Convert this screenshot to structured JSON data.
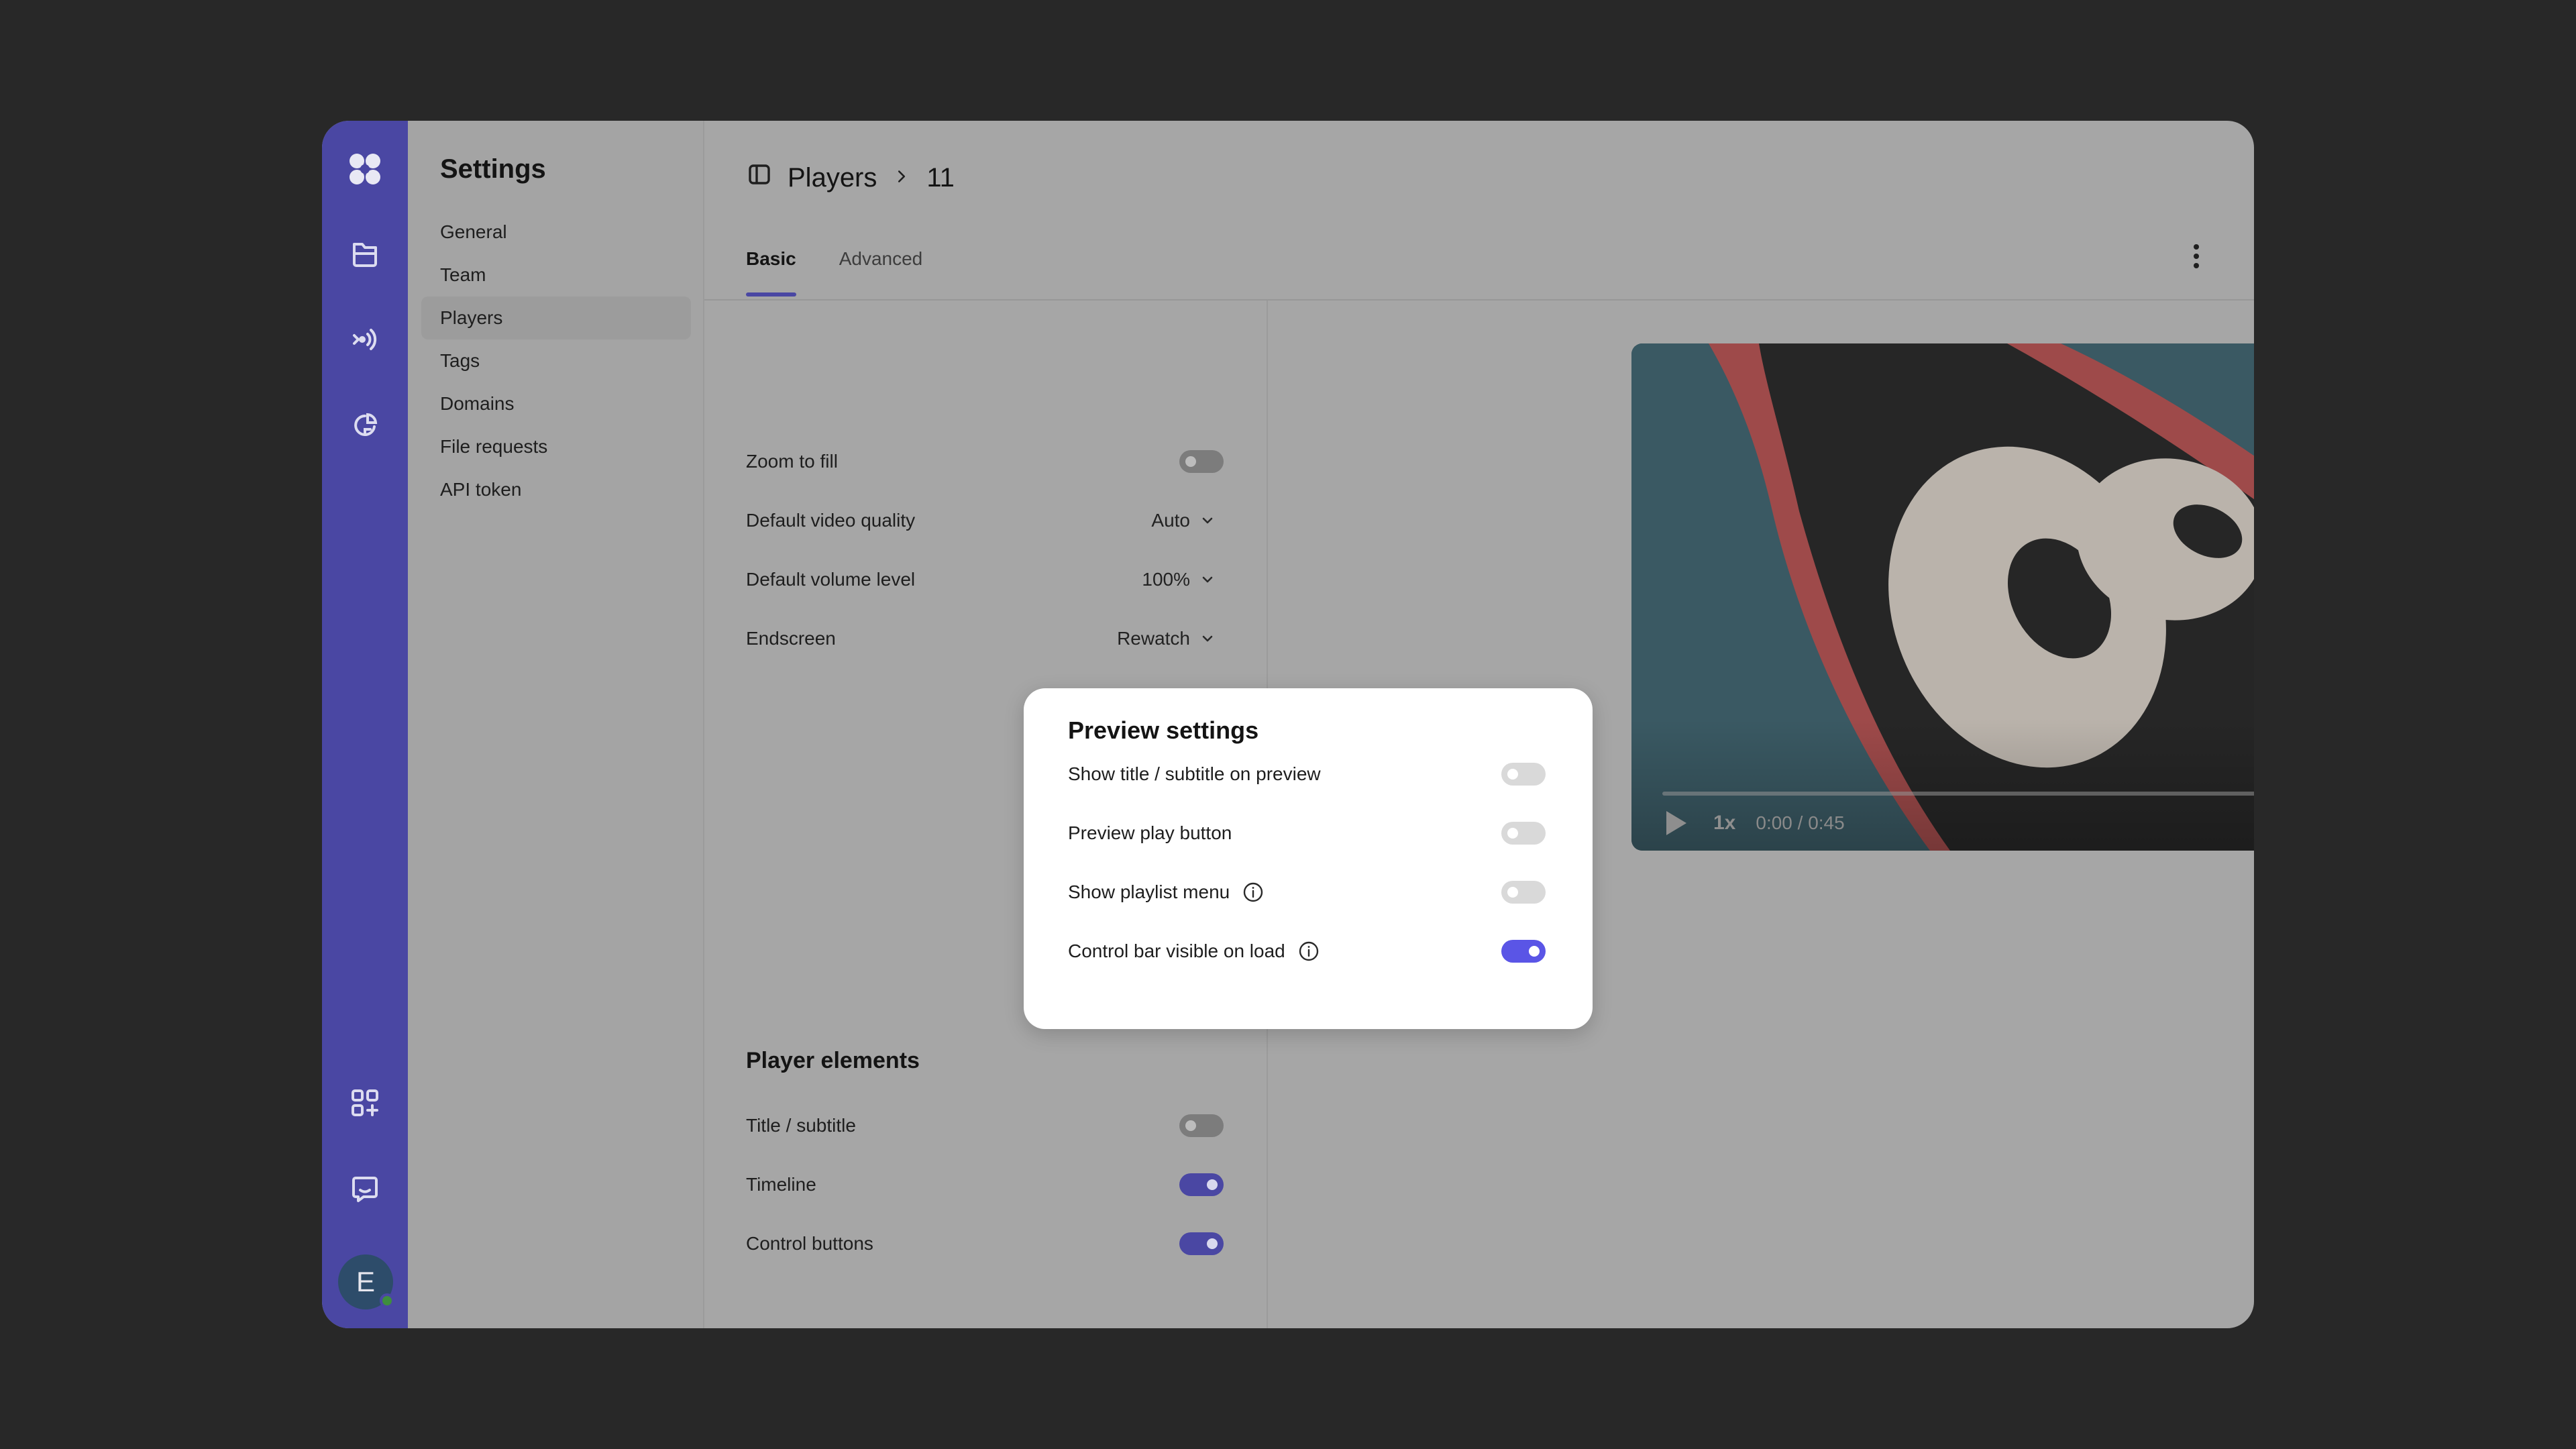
{
  "colors": {
    "accent": "#4a47a3",
    "toggle_on_popup": "#5a55e6",
    "window_bg": "#a6a6a6",
    "page_bg": "#282828"
  },
  "rail": {
    "icons": [
      "logo-icon",
      "folder-icon",
      "live-icon",
      "analytics-icon",
      "integrations-icon",
      "chat-icon"
    ],
    "avatar_letter": "E"
  },
  "settings": {
    "title": "Settings",
    "items": [
      {
        "label": "General",
        "active": false
      },
      {
        "label": "Team",
        "active": false
      },
      {
        "label": "Players",
        "active": true
      },
      {
        "label": "Tags",
        "active": false
      },
      {
        "label": "Domains",
        "active": false
      },
      {
        "label": "File requests",
        "active": false
      },
      {
        "label": "API token",
        "active": false
      }
    ]
  },
  "header": {
    "breadcrumb_root": "Players",
    "breadcrumb_current": "11"
  },
  "tabs": [
    {
      "label": "Basic",
      "active": true
    },
    {
      "label": "Advanced",
      "active": false
    }
  ],
  "basic": {
    "zoom_to_fill": {
      "label": "Zoom to fill",
      "on": false
    },
    "video_quality": {
      "label": "Default video quality",
      "value": "Auto"
    },
    "volume_level": {
      "label": "Default volume level",
      "value": "100%"
    },
    "endscreen": {
      "label": "Endscreen",
      "value": "Rewatch"
    }
  },
  "preview_settings": {
    "title": "Preview settings",
    "items": [
      {
        "label": "Show title / subtitle on preview",
        "on": false,
        "info": false
      },
      {
        "label": "Preview play button",
        "on": false,
        "info": false
      },
      {
        "label": "Show playlist menu",
        "on": false,
        "info": true
      },
      {
        "label": "Control bar visible on load",
        "on": true,
        "info": true
      }
    ]
  },
  "player_elements": {
    "title": "Player elements",
    "items": [
      {
        "label": "Title / subtitle",
        "on": false
      },
      {
        "label": "Timeline",
        "on": true
      },
      {
        "label": "Control buttons",
        "on": true
      }
    ]
  },
  "video": {
    "speed": "1x",
    "time": "0:00 / 0:45",
    "progress": 0
  }
}
